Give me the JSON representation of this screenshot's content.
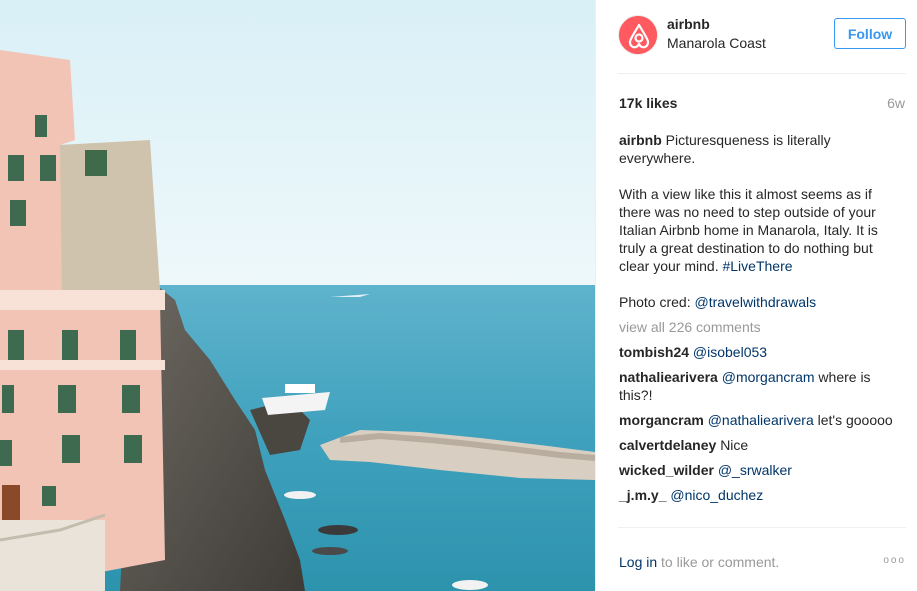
{
  "header": {
    "username": "airbnb",
    "location": "Manarola Coast",
    "follow_label": "Follow"
  },
  "meta": {
    "likes": "17k likes",
    "time": "6w"
  },
  "caption": {
    "author": "airbnb",
    "line1": "Picturesqueness is literally everywhere.",
    "line2": "With a view like this it almost seems as if there was no need to step outside of your Italian Airbnb home in Manarola, Italy. It is truly a great destination to do nothing but clear your mind.",
    "hashtag": "#LiveThere",
    "credit_prefix": "Photo cred:",
    "credit_handle": "@travelwithdrawals"
  },
  "comments": {
    "view_all": "view all 226 comments",
    "items": [
      {
        "user": "tombish24",
        "mention": "@isobel053",
        "text": ""
      },
      {
        "user": "nathaliearivera",
        "mention": "@morgancram",
        "text": "where is this?!"
      },
      {
        "user": "morgancram",
        "mention": "@nathaliearivera",
        "text": "let's gooooo"
      },
      {
        "user": "calvertdelaney",
        "mention": "",
        "text": "Nice"
      },
      {
        "user": "wicked_wilder",
        "mention": "@_srwalker",
        "text": ""
      },
      {
        "user": "_j.m.y_",
        "mention": "@nico_duchez",
        "text": ""
      }
    ]
  },
  "footer": {
    "login_label": "Log in",
    "login_suffix": "to like or comment.",
    "more_label": "ooo"
  },
  "colors": {
    "accent": "#3897f0",
    "link": "#003569",
    "muted": "#999999",
    "brand": "#ff5a5f"
  },
  "icons": {
    "avatar": "airbnb-logo-icon",
    "more": "more-options-icon"
  }
}
